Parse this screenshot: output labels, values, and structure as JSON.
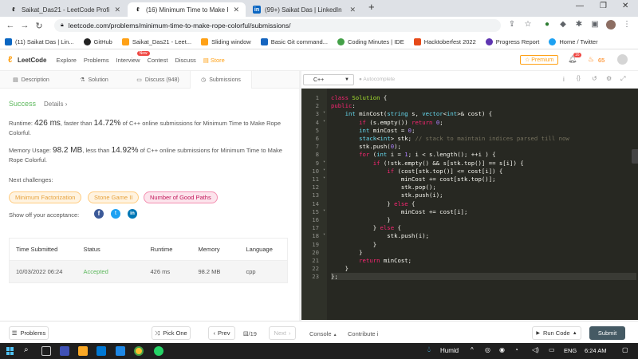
{
  "browser": {
    "tabs": [
      {
        "icon": "leetcode-icon",
        "title": "Saikat_Das21 - LeetCode Profile"
      },
      {
        "icon": "leetcode-icon",
        "title": "(16) Minimum Time to Make Rope"
      },
      {
        "icon": "linkedin-icon",
        "title": "(99+) Saikat Das | LinkedIn"
      }
    ],
    "url": "leetcode.com/problems/minimum-time-to-make-rope-colorful/submissions/",
    "bookmarks": [
      {
        "icon": "linkedin-icon",
        "label": "(11) Saikat Das | Lin..."
      },
      {
        "icon": "github-icon",
        "label": "GitHub"
      },
      {
        "icon": "leetcode-icon",
        "label": "Saikat_Das21 - Leet..."
      },
      {
        "icon": "leetcode-icon",
        "label": "Sliding window"
      },
      {
        "icon": "git-icon",
        "label": "Basic Git command..."
      },
      {
        "icon": "coding-minutes-icon",
        "label": "Coding Minutes | IDE"
      },
      {
        "icon": "hacktoberfest-icon",
        "label": "Hacktoberfest 2022"
      },
      {
        "icon": "progress-icon",
        "label": "Progress Report"
      },
      {
        "icon": "twitter-icon",
        "label": "Home / Twitter"
      }
    ]
  },
  "leetcode": {
    "logo": "LeetCode",
    "nav": [
      "Explore",
      "Problems",
      "Interview",
      "Contest",
      "Discuss",
      "Store"
    ],
    "new_badge": "New",
    "premium": "Premium",
    "notif_count": "16",
    "streak": "65"
  },
  "left_tabs": [
    "Description",
    "Solution",
    "Discuss (948)",
    "Submissions"
  ],
  "result": {
    "status": "Success",
    "details": "Details",
    "runtime_prefix": "Runtime: ",
    "runtime": "426 ms",
    "runtime_mid": ", faster than ",
    "runtime_pct": "14.72%",
    "runtime_suffix": " of C++ online submissions for Minimum Time to Make Rope Colorful.",
    "memory_prefix": "Memory Usage: ",
    "memory": "98.2 MB",
    "memory_mid": ", less than ",
    "memory_pct": "14.92%",
    "memory_suffix": " of C++ online submissions for Minimum Time to Make Rope Colorful.",
    "next_label": "Next challenges:",
    "challenges": [
      "Minimum Factorization",
      "Stone Game II",
      "Number of Good Paths"
    ],
    "share_label": "Show off your acceptance:"
  },
  "table": {
    "headers": [
      "Time Submitted",
      "Status",
      "Runtime",
      "Memory",
      "Language"
    ],
    "row": [
      "10/03/2022 06:24",
      "Accepted",
      "426 ms",
      "98.2 MB",
      "cpp"
    ]
  },
  "editor": {
    "language": "C++",
    "autocomplete": "Autocomplete",
    "code": [
      "class Solution {",
      "public:",
      "    int minCost(string s, vector<int>& cost) {",
      "        if (s.empty()) return 0;",
      "        int minCost = 0;",
      "        stack<int> stk; // stack to maintain indices parsed till now",
      "        stk.push(0);",
      "        for (int i = 1; i < s.length(); ++i ) {",
      "            if (!stk.empty() && s[stk.top()] == s[i]) {",
      "                if (cost[stk.top()] <= cost[i]) {",
      "                    minCost += cost[stk.top()];",
      "                    stk.pop();",
      "                    stk.push(i);",
      "                } else {",
      "                    minCost += cost[i];",
      "                }",
      "            } else {",
      "                stk.push(i);",
      "            }",
      "        }",
      "        return minCost;",
      "    }",
      "};"
    ]
  },
  "bottom": {
    "problems": "Problems",
    "pick_one": "Pick One",
    "prev": "Prev",
    "page": "/19",
    "next": "Next",
    "console": "Console",
    "contribute": "Contribute",
    "run_code": "Run Code",
    "submit": "Submit"
  },
  "taskbar": {
    "weather": "Humid",
    "lang": "ENG",
    "time": "6:24 AM"
  },
  "colors": {
    "success": "#5cb85c",
    "accent": "#ffa116",
    "editor_bg": "#272822",
    "submit_bg": "#455a64"
  }
}
